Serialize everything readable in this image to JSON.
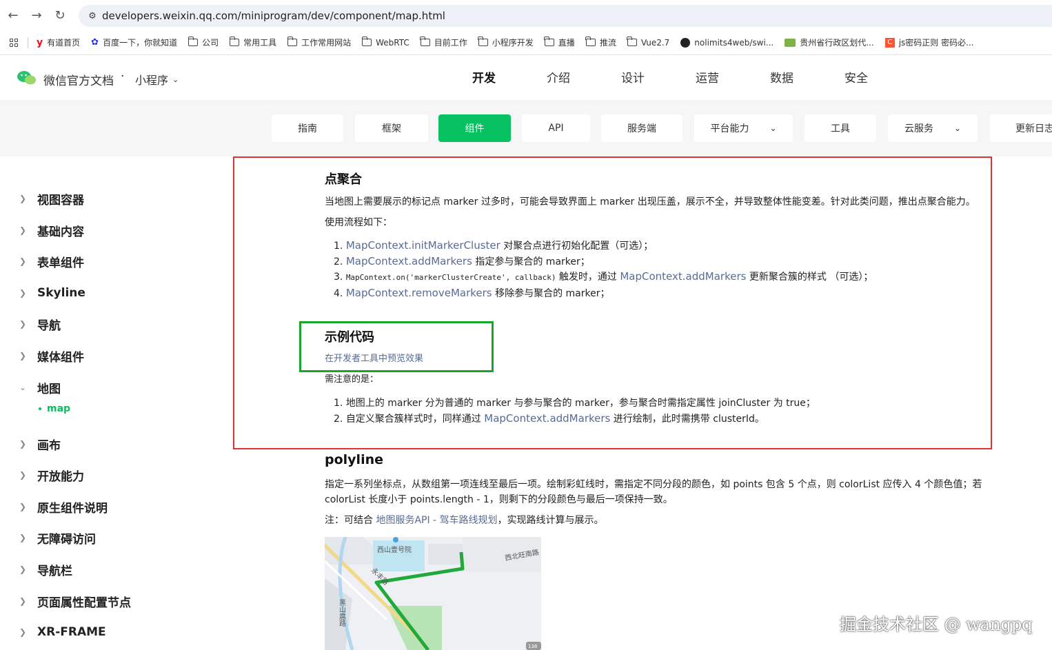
{
  "browser": {
    "url": "developers.weixin.qq.com/miniprogram/dev/component/map.html",
    "bookmarks": [
      {
        "label": "有道首页",
        "icon": "youdao-icon"
      },
      {
        "label": "百度一下，你就知道",
        "icon": "baidu-icon"
      },
      {
        "label": "公司",
        "icon": "folder-icon"
      },
      {
        "label": "常用工具",
        "icon": "folder-icon"
      },
      {
        "label": "工作常用网站",
        "icon": "folder-icon"
      },
      {
        "label": "WebRTC",
        "icon": "folder-icon"
      },
      {
        "label": "目前工作",
        "icon": "folder-icon"
      },
      {
        "label": "小程序开发",
        "icon": "folder-icon"
      },
      {
        "label": "直播",
        "icon": "folder-icon"
      },
      {
        "label": "推流",
        "icon": "folder-icon"
      },
      {
        "label": "Vue2.7",
        "icon": "folder-icon"
      },
      {
        "label": "nolimits4web/swi...",
        "icon": "github-icon"
      },
      {
        "label": "贵州省行政区划代...",
        "icon": "site-icon"
      },
      {
        "label": "js密码正则 密码必...",
        "icon": "csdn-icon"
      }
    ]
  },
  "header": {
    "brand": "微信官方文档",
    "dot": "·",
    "product": "小程序",
    "nav": [
      "开发",
      "介绍",
      "设计",
      "运营",
      "数据",
      "安全"
    ]
  },
  "subtabs": [
    "指南",
    "框架",
    "组件",
    "API",
    "服务端",
    "平台能力",
    "工具",
    "云服务",
    "更新日志"
  ],
  "sidebar": {
    "items": [
      "视图容器",
      "基础内容",
      "表单组件",
      "Skyline",
      "导航",
      "媒体组件",
      "地图",
      "画布",
      "开放能力",
      "原生组件说明",
      "无障碍访问",
      "导航栏",
      "页面属性配置节点",
      "XR-FRAME"
    ],
    "sub_item": "map"
  },
  "content": {
    "cluster_title": "点聚合",
    "cluster_desc": "当地图上需要展示的标记点 marker 过多时，可能会导致界面上 marker 出现压盖，展示不全，并导致整体性能变差。针对此类问题，推出点聚合能力。",
    "flow_label": "使用流程如下：",
    "steps": [
      {
        "num": "1.",
        "link": "MapContext.initMarkerCluster",
        "text": " 对聚合点进行初始化配置（可选）；"
      },
      {
        "num": "2.",
        "link": "MapContext.addMarkers",
        "text": " 指定参与聚合的 marker；"
      },
      {
        "num": "3.",
        "code": "MapContext.on('markerClusterCreate', callback)",
        "mid": " 触发时，通过 ",
        "link": "MapContext.addMarkers",
        "text": " 更新聚合簇的样式 （可选）；"
      },
      {
        "num": "4.",
        "link": "MapContext.removeMarkers",
        "text": " 移除参与聚合的 marker；"
      }
    ],
    "example_title": "示例代码",
    "example_link": "在开发者工具中预览效果",
    "notes_label": "需注意的是：",
    "notes": [
      {
        "num": "1.",
        "text": "地图上的 marker 分为普通的 marker 与参与聚合的 marker，参与聚合时需指定属性 joinCluster 为 true；"
      },
      {
        "num": "2.",
        "pre": "自定义聚合簇样式时，同样通过 ",
        "link": "MapContext.addMarkers",
        "text": " 进行绘制，此时需携带 clusterId。"
      }
    ],
    "polyline_title": "polyline",
    "polyline_desc_1": "指定一系列坐标点，从数组第一项连线至最后一项。绘制彩虹线时，需指定不同分段的颜色，如 points 包含 5 个点，则 colorList 应传入 4 个颜色值；若",
    "polyline_desc_2": "colorList 长度小于 points.length - 1，则剩下的分段颜色与最后一项保持一致。",
    "polyline_note_pre": "注：可结合 ",
    "polyline_note_link": "地图服务API - 驾车路线规划",
    "polyline_note_post": "，实现路线计算与展示。",
    "map_labels": [
      "西山壹号院",
      "永丰路",
      "西北旺南路",
      "黑山扈路",
      "138"
    ]
  },
  "watermark": "掘金技术社区 @ wangpq",
  "colors": {
    "accent": "#07c160",
    "link": "#576b95",
    "highlight_red": "#e0312c",
    "highlight_green": "#1aa52b"
  }
}
